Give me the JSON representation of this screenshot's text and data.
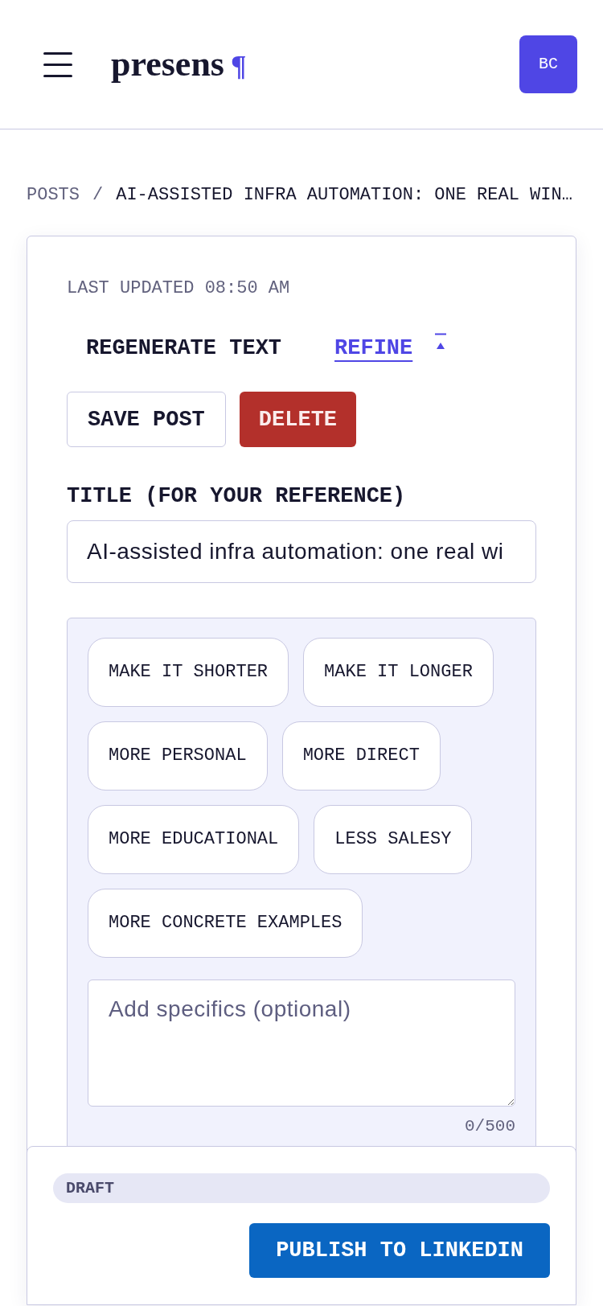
{
  "header": {
    "logo": {
      "wordmark": "presens",
      "mark": "¶"
    },
    "avatar": {
      "initials": "BC"
    }
  },
  "breadcrumb": {
    "items": [
      {
        "label": "POSTS"
      },
      {
        "label": "AI-ASSISTED INFRA AUTOMATION: ONE REAL WIN…"
      }
    ],
    "separator": "/"
  },
  "card": {
    "last_updated": "LAST UPDATED 08:50 AM",
    "tabs": [
      {
        "label": "REGENERATE TEXT",
        "selected": false
      },
      {
        "label": "REFINE",
        "selected": true
      }
    ],
    "refine_expanded": true,
    "actions": [
      {
        "label": "SAVE POST",
        "kind": "outline"
      },
      {
        "label": "DELETE",
        "kind": "danger"
      }
    ],
    "title_field": {
      "label": "TITLE (FOR YOUR REFERENCE)",
      "value": "AI-assisted infra automation: one real wi"
    },
    "refine_panel": {
      "chips": [
        "MAKE IT SHORTER",
        "MAKE IT LONGER",
        "MORE PERSONAL",
        "MORE DIRECT",
        "MORE EDUCATIONAL",
        "LESS SALESY",
        "MORE CONCRETE EXAMPLES"
      ],
      "specifics": {
        "placeholder": "Add specifics (optional)",
        "counter": "0/500"
      }
    }
  },
  "footer": {
    "status": "DRAFT",
    "publish_button": "PUBLISH TO LINKEDIN"
  }
}
